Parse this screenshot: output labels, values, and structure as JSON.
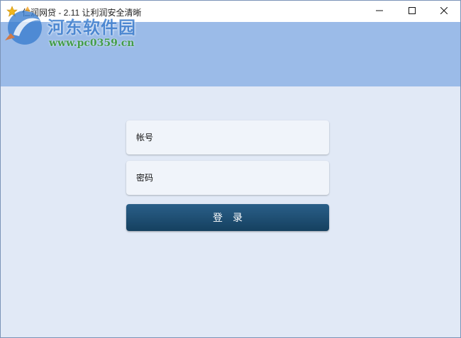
{
  "window": {
    "title": "仁润网贷 - 2.11 让利润安全清晰",
    "controls": {
      "minimize": "minimize-icon",
      "maximize": "maximize-icon",
      "close": "close-icon"
    }
  },
  "watermark": {
    "title": "河东软件园",
    "url": "www.pc0359.cn"
  },
  "login": {
    "account_placeholder": "帐号",
    "password_placeholder": "密码",
    "submit_label": "登录"
  },
  "colors": {
    "header_band": "#9bbbe8",
    "background": "#e1e9f6",
    "button": "#1a4a6e",
    "field": "#f0f4fa"
  }
}
